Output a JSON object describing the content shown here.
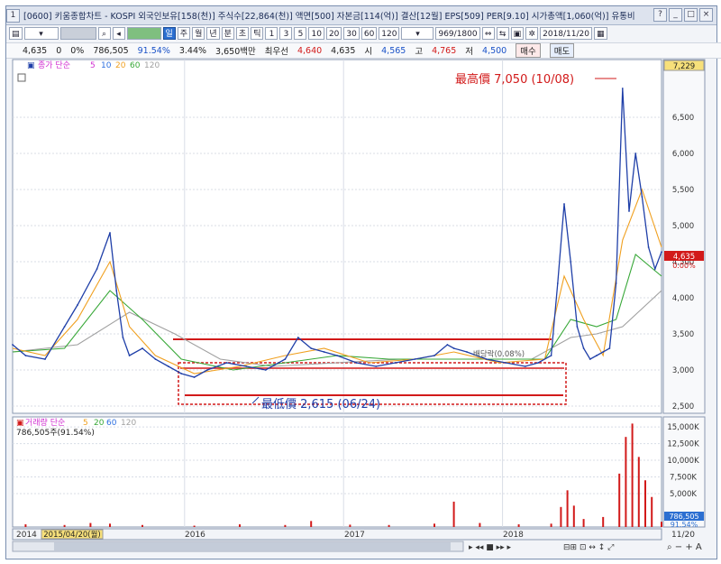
{
  "window": {
    "title": "[0600] 키움종합차트 - KOSPI 외국인보유[158(천)] 주식수[22,864(천)] 액면[500] 자본금[114(억)] 결산[12월] EPS[509] PER[9.10] 시가총액[1,060(억)] 유통비",
    "controls": [
      "?",
      "_",
      "□",
      "×"
    ]
  },
  "toolbar": {
    "period_buttons": [
      "일",
      "주",
      "월",
      "년",
      "분",
      "초",
      "틱"
    ],
    "interval_buttons": [
      "1",
      "3",
      "5",
      "10",
      "20",
      "30",
      "60",
      "120"
    ],
    "bar_count": "969/1800",
    "date": "2018/11/20"
  },
  "quote": {
    "price": "4,635",
    "change": "0",
    "change_pct": "0%",
    "volume": "786,505",
    "volume_ratio": "91.54%",
    "turnover": "3.44%",
    "amount": "3,650백만",
    "priority_label": "최우선",
    "priority_value": "4,640",
    "open_value": "4,635",
    "open_label": "시",
    "open2": "4,565",
    "high_label": "고",
    "high": "4,765",
    "low_label": "저",
    "low": "4,500",
    "buy_btn": "매수",
    "sell_btn": "매도"
  },
  "colors": {
    "price": "#1f3fa8",
    "ma5": "#d12fd1",
    "ma10": "#2c6fe0",
    "ma20": "#f0a020",
    "ma60": "#38a838",
    "ma120": "#a0a0a0",
    "volume": "#d21a1a",
    "annotation": "#d21a1a"
  },
  "chart_data": [
    {
      "type": "line",
      "legend": {
        "label": "종가 단순",
        "periods": [
          "5",
          "10",
          "20",
          "60",
          "120"
        ]
      },
      "x_axis": {
        "labels": [
          "2014",
          "2016",
          "2017",
          "2018",
          "11/20"
        ]
      },
      "y_axis": {
        "side": "right",
        "ticks": [
          2500,
          3000,
          3500,
          4000,
          4500,
          5000,
          5500,
          6000,
          6500
        ],
        "tick_labels": [
          "2,500",
          "3,000",
          "3,500",
          "4,000",
          "4,500",
          "5,000",
          "5,500",
          "6,000",
          "6,500"
        ],
        "range": [
          2400,
          7300
        ],
        "top_label": "7,229",
        "current": "4,635",
        "current_pct": "0.00%"
      },
      "series": [
        {
          "key": "price",
          "x": [
            0,
            0.02,
            0.05,
            0.08,
            0.1,
            0.13,
            0.15,
            0.16,
            0.17,
            0.18,
            0.2,
            0.22,
            0.24,
            0.26,
            0.28,
            0.3,
            0.33,
            0.36,
            0.39,
            0.42,
            0.44,
            0.46,
            0.48,
            0.5,
            0.53,
            0.56,
            0.59,
            0.62,
            0.65,
            0.67,
            0.68,
            0.7,
            0.73,
            0.76,
            0.79,
            0.81,
            0.83,
            0.84,
            0.85,
            0.86,
            0.87,
            0.88,
            0.89,
            0.9,
            0.91,
            0.92,
            0.93,
            0.94,
            0.95,
            0.96,
            0.97,
            0.98,
            0.99,
            1.0
          ],
          "y": [
            3350,
            3200,
            3150,
            3600,
            3900,
            4400,
            4900,
            4100,
            3450,
            3200,
            3300,
            3150,
            3050,
            2950,
            2900,
            3000,
            3100,
            3050,
            3000,
            3150,
            3450,
            3300,
            3250,
            3200,
            3100,
            3050,
            3100,
            3150,
            3200,
            3350,
            3300,
            3250,
            3150,
            3100,
            3050,
            3100,
            3200,
            4200,
            5300,
            4500,
            3600,
            3300,
            3150,
            3200,
            3250,
            3300,
            4200,
            6900,
            5200,
            6000,
            5400,
            4700,
            4400,
            4635
          ]
        },
        {
          "key": "ma20",
          "x": [
            0,
            0.05,
            0.1,
            0.15,
            0.18,
            0.22,
            0.28,
            0.35,
            0.42,
            0.48,
            0.55,
            0.62,
            0.68,
            0.75,
            0.82,
            0.85,
            0.88,
            0.91,
            0.94,
            0.97,
            1.0
          ],
          "y": [
            3300,
            3200,
            3700,
            4500,
            3600,
            3200,
            2950,
            3050,
            3200,
            3300,
            3100,
            3150,
            3250,
            3100,
            3150,
            4300,
            3700,
            3200,
            4800,
            5500,
            4700
          ]
        },
        {
          "key": "ma60",
          "x": [
            0,
            0.08,
            0.15,
            0.2,
            0.26,
            0.34,
            0.42,
            0.5,
            0.58,
            0.66,
            0.74,
            0.82,
            0.86,
            0.9,
            0.93,
            0.96,
            1.0
          ],
          "y": [
            3250,
            3300,
            4100,
            3700,
            3150,
            3000,
            3100,
            3200,
            3150,
            3150,
            3150,
            3150,
            3700,
            3600,
            3700,
            4600,
            4300
          ]
        },
        {
          "key": "ma120",
          "x": [
            0,
            0.1,
            0.18,
            0.25,
            0.32,
            0.4,
            0.5,
            0.6,
            0.7,
            0.8,
            0.86,
            0.9,
            0.94,
            1.0
          ],
          "y": [
            3250,
            3350,
            3800,
            3500,
            3150,
            3050,
            3100,
            3150,
            3150,
            3150,
            3450,
            3500,
            3600,
            4100
          ]
        }
      ],
      "annotations": {
        "high": "最高價 7,050 (10/08)",
        "low": "最低價 2,615 (06/24)",
        "ex_dividend": "배당락(0.08%)"
      }
    },
    {
      "type": "bar",
      "legend": {
        "label": "거래량 단순",
        "periods": [
          "5",
          "20",
          "60",
          "120"
        ],
        "current": "786,505주(91.54%)"
      },
      "y_axis": {
        "side": "right",
        "ticks": [
          5000,
          7500,
          10000,
          12500,
          15000
        ],
        "tick_labels": [
          "5,000K",
          "7,500K",
          "10,000K",
          "12,500K",
          "15,000K"
        ],
        "range": [
          0,
          16500
        ],
        "current": "786,505",
        "current_pct": "91.54%"
      },
      "x": [
        0.02,
        0.08,
        0.12,
        0.15,
        0.2,
        0.28,
        0.35,
        0.42,
        0.46,
        0.52,
        0.58,
        0.65,
        0.68,
        0.72,
        0.78,
        0.83,
        0.845,
        0.855,
        0.865,
        0.88,
        0.91,
        0.935,
        0.945,
        0.955,
        0.965,
        0.975,
        0.985,
        1.0
      ],
      "values": [
        400,
        300,
        600,
        500,
        300,
        200,
        400,
        300,
        900,
        350,
        300,
        500,
        3800,
        600,
        400,
        500,
        3000,
        5500,
        3200,
        1200,
        1500,
        8000,
        13500,
        15500,
        10500,
        7000,
        4500,
        786
      ]
    }
  ],
  "bottom_axis": {
    "labels": [
      "2014",
      "2015/04/20(월)",
      "2016",
      "2017",
      "2018",
      "11/20"
    ]
  }
}
